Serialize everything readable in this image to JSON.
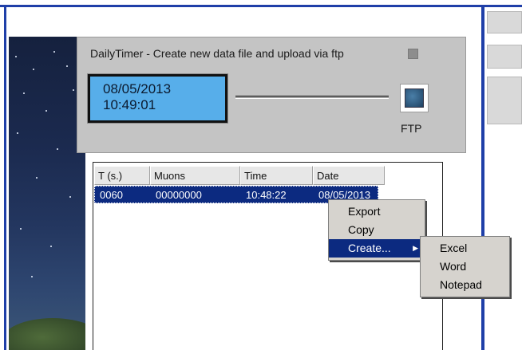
{
  "timer": {
    "title": "DailyTimer - Create new data file and upload via ftp",
    "date": "08/05/2013",
    "time": "10:49:01",
    "ftp_label": "FTP"
  },
  "table": {
    "columns": [
      "T (s.)",
      "Muons",
      "Time",
      "Date"
    ],
    "rows": [
      [
        "0060",
        "00000000",
        "10:48:22",
        "08/05/2013"
      ]
    ]
  },
  "context_menu": {
    "items": [
      "Export",
      "Copy",
      "Create..."
    ]
  },
  "submenu": {
    "items": [
      "Excel",
      "Word",
      "Notepad"
    ]
  },
  "icons": {
    "submenu_arrow": "chevron-right-icon"
  },
  "colors": {
    "lcd_background": "#57aeea",
    "selection": "#0c2a80",
    "frame_border": "#1f3fa8",
    "panel": "#c4c4c4",
    "menu": "#d6d3ce"
  }
}
